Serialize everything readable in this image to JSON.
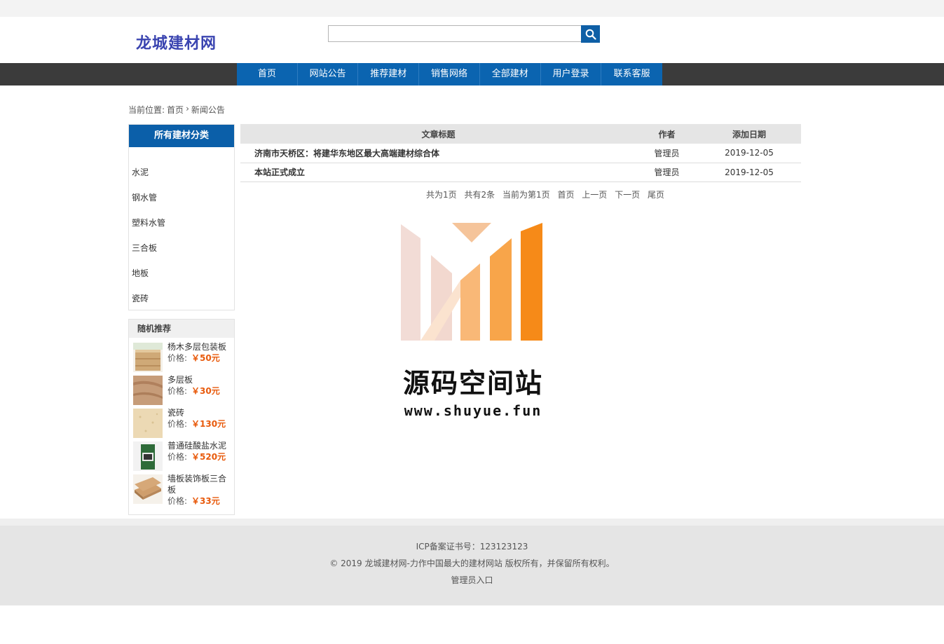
{
  "site": {
    "logo": "龙城建材网"
  },
  "search": {
    "placeholder": ""
  },
  "nav": {
    "items": [
      "首页",
      "网站公告",
      "推荐建材",
      "销售网络",
      "全部建材",
      "用户登录",
      "联系客服"
    ]
  },
  "breadcrumb": {
    "prefix": "当前位置:",
    "home": "首页",
    "separator": "›",
    "current": "新闻公告"
  },
  "categories": {
    "header": "所有建材分类",
    "items": [
      "水泥",
      "钢水管",
      "塑料水管",
      "三合板",
      "地板",
      "瓷砖"
    ]
  },
  "recommend": {
    "header": "随机推荐",
    "price_label": "价格:",
    "items": [
      {
        "name": "杨木多层包装板",
        "price": "￥50元"
      },
      {
        "name": "多层板",
        "price": "￥30元"
      },
      {
        "name": "瓷砖",
        "price": "￥130元"
      },
      {
        "name": "普通硅酸盐水泥",
        "price": "￥520元"
      },
      {
        "name": "墙板装饰板三合板",
        "price": "￥33元"
      }
    ]
  },
  "articles": {
    "headers": {
      "title": "文章标题",
      "author": "作者",
      "date": "添加日期"
    },
    "rows": [
      {
        "title": "济南市天桥区：将建华东地区最大高端建材综合体",
        "author": "管理员",
        "date": "2019-12-05"
      },
      {
        "title": "本站正式成立",
        "author": "管理员",
        "date": "2019-12-05"
      }
    ]
  },
  "pagination": {
    "total_pages": "共为1页",
    "total_items": "共有2条",
    "current": "当前为第1页",
    "first": "首页",
    "prev": "上一页",
    "next": "下一页",
    "last": "尾页"
  },
  "watermark": {
    "text": "源码空间站",
    "url": "www.shuyue.fun"
  },
  "footer": {
    "icp": "ICP备案证书号：123123123",
    "copyright": "© 2019 龙城建材网-力作中国最大的建材网站 版权所有，并保留所有权利。",
    "admin_link": "管理员入口"
  },
  "colors": {
    "nav_blue": "#0b64b0",
    "nav_dark": "#3b3b3b",
    "price_orange": "#e85a0c",
    "logo_blue": "#3a44b0"
  }
}
